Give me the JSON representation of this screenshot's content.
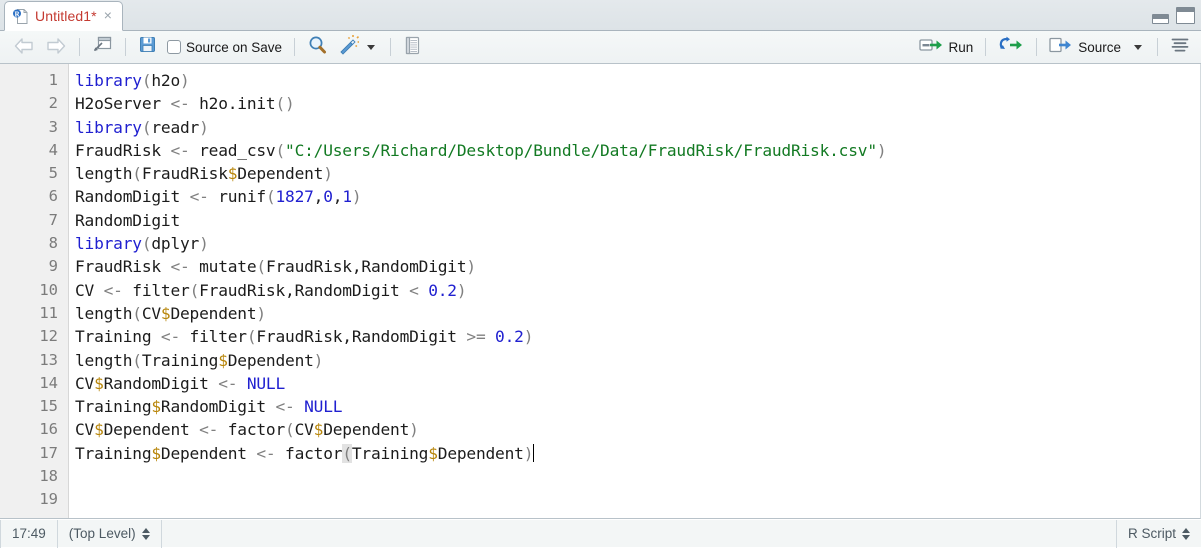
{
  "window": {
    "minimize_label": "minimize-pane",
    "maximize_label": "maximize-pane"
  },
  "tab": {
    "title": "Untitled1*",
    "close_label": "×",
    "icon": "r-script-doc-icon"
  },
  "toolbar": {
    "back_label": "back-icon",
    "forward_label": "forward-icon",
    "popout_label": "show-in-new-window-icon",
    "save_label": "save-icon",
    "source_on_save_label": "Source on Save",
    "find_label": "search-icon",
    "code_tools_label": "magic-wand-icon",
    "compile_report_label": "compile-report-icon",
    "run_label": "Run",
    "rerun_label": "re-run-previous-icon",
    "source_label": "Source",
    "outline_label": "document-outline-icon"
  },
  "statusbar": {
    "cursor_position": "17:49",
    "scope": "(Top Level)",
    "file_type": "R Script"
  },
  "editor": {
    "line_numbers": [
      "1",
      "2",
      "3",
      "4",
      "5",
      "6",
      "7",
      "8",
      "9",
      "10",
      "11",
      "12",
      "13",
      "14",
      "15",
      "16",
      "17",
      "18",
      "19"
    ],
    "lines": [
      [
        {
          "t": "library",
          "c": "tk-kw"
        },
        {
          "t": "(",
          "c": "tk-paren"
        },
        {
          "t": "h2o",
          "c": "tk-plain"
        },
        {
          "t": ")",
          "c": "tk-paren"
        }
      ],
      [
        {
          "t": "H2oServer ",
          "c": "tk-plain"
        },
        {
          "t": "<-",
          "c": "tk-op"
        },
        {
          "t": " h2o.init",
          "c": "tk-plain"
        },
        {
          "t": "()",
          "c": "tk-paren"
        }
      ],
      [
        {
          "t": "library",
          "c": "tk-kw"
        },
        {
          "t": "(",
          "c": "tk-paren"
        },
        {
          "t": "readr",
          "c": "tk-plain"
        },
        {
          "t": ")",
          "c": "tk-paren"
        }
      ],
      [
        {
          "t": "FraudRisk ",
          "c": "tk-plain"
        },
        {
          "t": "<-",
          "c": "tk-op"
        },
        {
          "t": " read_csv",
          "c": "tk-plain"
        },
        {
          "t": "(",
          "c": "tk-paren"
        },
        {
          "t": "\"C:/Users/Richard/Desktop/Bundle/Data/FraudRisk/FraudRisk.csv\"",
          "c": "tk-str"
        },
        {
          "t": ")",
          "c": "tk-paren"
        }
      ],
      [
        {
          "t": "length",
          "c": "tk-plain"
        },
        {
          "t": "(",
          "c": "tk-paren"
        },
        {
          "t": "FraudRisk",
          "c": "tk-plain"
        },
        {
          "t": "$",
          "c": "tk-dollar"
        },
        {
          "t": "Dependent",
          "c": "tk-plain"
        },
        {
          "t": ")",
          "c": "tk-paren"
        }
      ],
      [
        {
          "t": "RandomDigit ",
          "c": "tk-plain"
        },
        {
          "t": "<-",
          "c": "tk-op"
        },
        {
          "t": " runif",
          "c": "tk-plain"
        },
        {
          "t": "(",
          "c": "tk-paren"
        },
        {
          "t": "1827",
          "c": "tk-num"
        },
        {
          "t": ",",
          "c": "tk-plain"
        },
        {
          "t": "0",
          "c": "tk-num"
        },
        {
          "t": ",",
          "c": "tk-plain"
        },
        {
          "t": "1",
          "c": "tk-num"
        },
        {
          "t": ")",
          "c": "tk-paren"
        }
      ],
      [
        {
          "t": "RandomDigit",
          "c": "tk-plain"
        }
      ],
      [
        {
          "t": "library",
          "c": "tk-kw"
        },
        {
          "t": "(",
          "c": "tk-paren"
        },
        {
          "t": "dplyr",
          "c": "tk-plain"
        },
        {
          "t": ")",
          "c": "tk-paren"
        }
      ],
      [
        {
          "t": "FraudRisk ",
          "c": "tk-plain"
        },
        {
          "t": "<-",
          "c": "tk-op"
        },
        {
          "t": " mutate",
          "c": "tk-plain"
        },
        {
          "t": "(",
          "c": "tk-paren"
        },
        {
          "t": "FraudRisk,RandomDigit",
          "c": "tk-plain"
        },
        {
          "t": ")",
          "c": "tk-paren"
        }
      ],
      [
        {
          "t": "CV ",
          "c": "tk-plain"
        },
        {
          "t": "<-",
          "c": "tk-op"
        },
        {
          "t": " filter",
          "c": "tk-plain"
        },
        {
          "t": "(",
          "c": "tk-paren"
        },
        {
          "t": "FraudRisk,RandomDigit ",
          "c": "tk-plain"
        },
        {
          "t": "<",
          "c": "tk-op"
        },
        {
          "t": " ",
          "c": "tk-plain"
        },
        {
          "t": "0.2",
          "c": "tk-num"
        },
        {
          "t": ")",
          "c": "tk-paren"
        }
      ],
      [
        {
          "t": "length",
          "c": "tk-plain"
        },
        {
          "t": "(",
          "c": "tk-paren"
        },
        {
          "t": "CV",
          "c": "tk-plain"
        },
        {
          "t": "$",
          "c": "tk-dollar"
        },
        {
          "t": "Dependent",
          "c": "tk-plain"
        },
        {
          "t": ")",
          "c": "tk-paren"
        }
      ],
      [
        {
          "t": "Training ",
          "c": "tk-plain"
        },
        {
          "t": "<-",
          "c": "tk-op"
        },
        {
          "t": " filter",
          "c": "tk-plain"
        },
        {
          "t": "(",
          "c": "tk-paren"
        },
        {
          "t": "FraudRisk,RandomDigit ",
          "c": "tk-plain"
        },
        {
          "t": ">=",
          "c": "tk-op"
        },
        {
          "t": " ",
          "c": "tk-plain"
        },
        {
          "t": "0.2",
          "c": "tk-num"
        },
        {
          "t": ")",
          "c": "tk-paren"
        }
      ],
      [
        {
          "t": "length",
          "c": "tk-plain"
        },
        {
          "t": "(",
          "c": "tk-paren"
        },
        {
          "t": "Training",
          "c": "tk-plain"
        },
        {
          "t": "$",
          "c": "tk-dollar"
        },
        {
          "t": "Dependent",
          "c": "tk-plain"
        },
        {
          "t": ")",
          "c": "tk-paren"
        }
      ],
      [
        {
          "t": "CV",
          "c": "tk-plain"
        },
        {
          "t": "$",
          "c": "tk-dollar"
        },
        {
          "t": "RandomDigit ",
          "c": "tk-plain"
        },
        {
          "t": "<-",
          "c": "tk-op"
        },
        {
          "t": " ",
          "c": "tk-plain"
        },
        {
          "t": "NULL",
          "c": "tk-kw"
        }
      ],
      [
        {
          "t": "Training",
          "c": "tk-plain"
        },
        {
          "t": "$",
          "c": "tk-dollar"
        },
        {
          "t": "RandomDigit ",
          "c": "tk-plain"
        },
        {
          "t": "<-",
          "c": "tk-op"
        },
        {
          "t": " ",
          "c": "tk-plain"
        },
        {
          "t": "NULL",
          "c": "tk-kw"
        }
      ],
      [
        {
          "t": "CV",
          "c": "tk-plain"
        },
        {
          "t": "$",
          "c": "tk-dollar"
        },
        {
          "t": "Dependent ",
          "c": "tk-plain"
        },
        {
          "t": "<-",
          "c": "tk-op"
        },
        {
          "t": " factor",
          "c": "tk-plain"
        },
        {
          "t": "(",
          "c": "tk-paren"
        },
        {
          "t": "CV",
          "c": "tk-plain"
        },
        {
          "t": "$",
          "c": "tk-dollar"
        },
        {
          "t": "Dependent",
          "c": "tk-plain"
        },
        {
          "t": ")",
          "c": "tk-paren"
        }
      ],
      [
        {
          "t": "Training",
          "c": "tk-plain"
        },
        {
          "t": "$",
          "c": "tk-dollar"
        },
        {
          "t": "Dependent ",
          "c": "tk-plain"
        },
        {
          "t": "<-",
          "c": "tk-op"
        },
        {
          "t": " factor",
          "c": "tk-plain"
        },
        {
          "t": "(",
          "c": "tk-brmatch"
        },
        {
          "t": "Training",
          "c": "tk-plain"
        },
        {
          "t": "$",
          "c": "tk-dollar"
        },
        {
          "t": "Dependent",
          "c": "tk-plain"
        },
        {
          "t": ")",
          "c": "tk-paren"
        },
        {
          "t": "",
          "c": "caret"
        }
      ],
      [],
      []
    ]
  }
}
